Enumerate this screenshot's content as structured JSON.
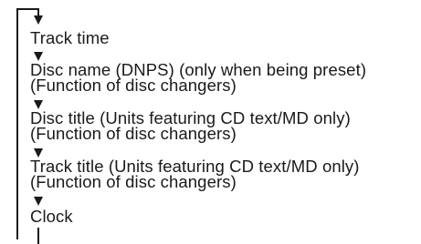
{
  "flow": {
    "steps": [
      {
        "label": "Track time",
        "note": ""
      },
      {
        "label": "Disc name (DNPS) (only when being preset)",
        "note": "(Function of disc changers)"
      },
      {
        "label": "Disc title (Units featuring CD text/MD only)",
        "note": "(Function of disc changers)"
      },
      {
        "label": "Track title (Units featuring CD text/MD only)",
        "note": "(Function of disc changers)"
      },
      {
        "label": "Clock",
        "note": ""
      }
    ]
  }
}
